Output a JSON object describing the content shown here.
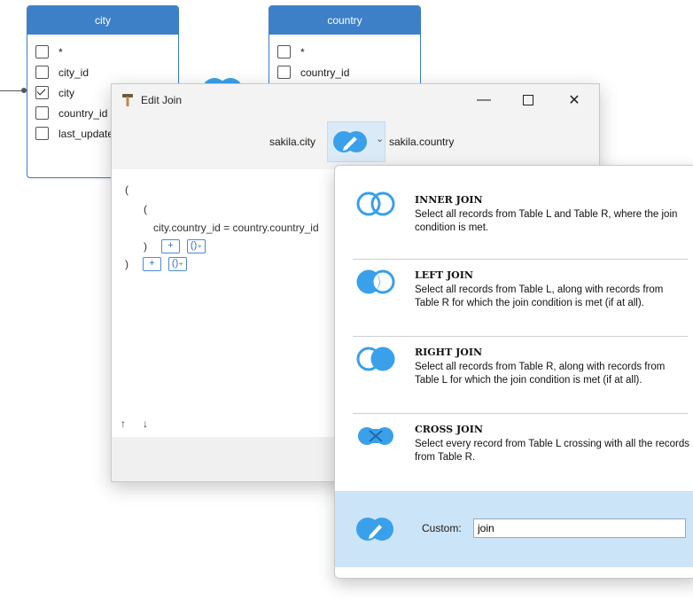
{
  "tables": {
    "city": {
      "title": "city",
      "columns": [
        {
          "label": "*",
          "checked": false
        },
        {
          "label": "city_id",
          "checked": false
        },
        {
          "label": "city",
          "checked": true
        },
        {
          "label": "country_id",
          "checked": false
        },
        {
          "label": "last_update",
          "checked": false
        }
      ]
    },
    "country": {
      "title": "country",
      "columns": [
        {
          "label": "*",
          "checked": false
        },
        {
          "label": "country_id",
          "checked": false
        }
      ]
    }
  },
  "dialog": {
    "title": "Edit Join",
    "left_table": "sakila.city",
    "right_table": "sakila.country",
    "minimize_glyph": "—",
    "close_glyph": "✕",
    "chevron_glyph": "⌄",
    "condition": {
      "open_outer": "(",
      "open_inner": "(",
      "expression": "city.country_id = country.country_id",
      "close_inner": ")",
      "close_outer": ")",
      "add_label": "+",
      "add_group_label": "()₊"
    },
    "move_up": "↑",
    "move_down": "↓"
  },
  "join_menu": {
    "options": [
      {
        "type": "INNER JOIN",
        "description": "Select all records from Table L and Table R, where the join condition is met.",
        "icon": "inner-join-icon"
      },
      {
        "type": "LEFT JOIN",
        "description": "Select all records from Table L, along with records from Table R for which the join condition is met (if at all).",
        "icon": "left-join-icon"
      },
      {
        "type": "RIGHT JOIN",
        "description": "Select all records from Table R, along with records from Table L for which the join condition is met (if at all).",
        "icon": "right-join-icon"
      },
      {
        "type": "CROSS JOIN",
        "description": "Select every record from Table L crossing with all the records from Table R.",
        "icon": "cross-join-icon"
      }
    ],
    "custom_label": "Custom:",
    "custom_value": "join"
  },
  "colors": {
    "accent": "#3d80c8",
    "join_icon": "#3aa0ea",
    "selected_bg": "#cce4f7"
  }
}
